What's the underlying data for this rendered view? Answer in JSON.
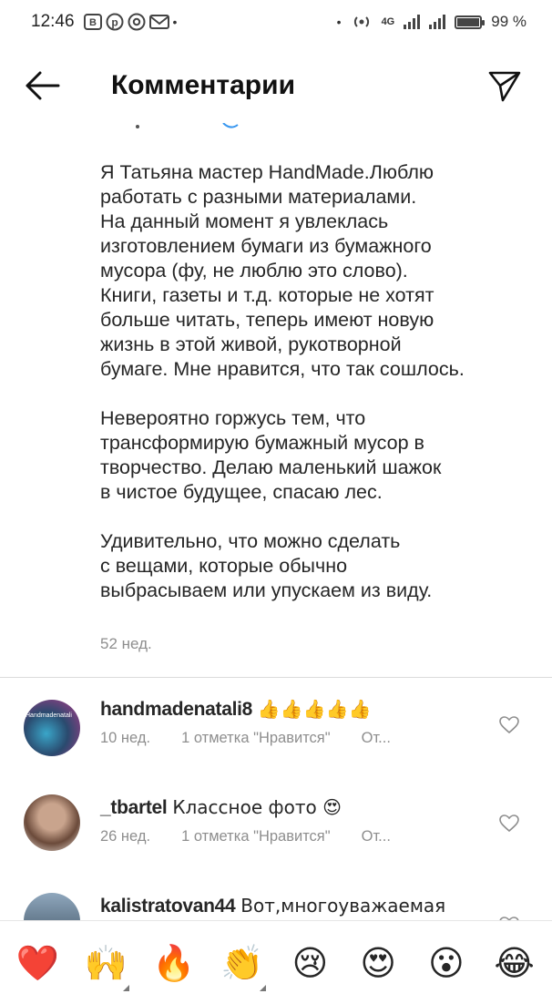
{
  "status_bar": {
    "time": "12:46",
    "left_icons": [
      "notification-b-icon",
      "pinterest-icon",
      "at-icon",
      "mail-icon"
    ],
    "network": "4G",
    "battery": "99 %",
    "battery_level": 0.99
  },
  "header": {
    "title": "Комментарии",
    "back_icon": "arrow-left-icon",
    "send_icon": "paper-plane-icon"
  },
  "caption": {
    "paragraphs": [
      [
        "Я Татьяна мастер HandMade.Люблю",
        "работать с разными материалами.",
        "На данный момент я увлеклась",
        "изготовлением бумаги из бумажного",
        "мусора (фу, не люблю это слово).",
        "Книги, газеты и т.д. которые не хотят",
        "больше читать, теперь имеют новую",
        "жизнь в этой живой, рукотворной",
        "бумаге. Мне нравится, что так сошлось."
      ],
      [
        "Невероятно горжусь тем, что",
        "трансформирую бумажный мусор в",
        "творчество. Делаю маленький шажок",
        "в чистое будущее, спасаю лес."
      ],
      [
        "Удивительно, что можно сделать",
        "с вещами, которые обычно",
        "выбрасываем или упускаем из виду."
      ]
    ],
    "time": "52 нед."
  },
  "comments": [
    {
      "username": "handmadenatali8",
      "text": "👍👍👍👍👍",
      "time": "10 нед.",
      "likes": "1 отметка \"Нравится\"",
      "reply": "От...",
      "avatar_label": "Handmadenatali",
      "avatar_colors": [
        "#2a4a6e",
        "#3aa6c9",
        "#b23a8a"
      ]
    },
    {
      "username": "_tbartel",
      "text": "Классное фото 😍",
      "time": "26 нед.",
      "likes": "1 отметка \"Нравится\"",
      "reply": "От...",
      "avatar_colors": [
        "#c9a48d",
        "#6b4a3a",
        "#efe4dc"
      ]
    },
    {
      "username": "kalistratovan44",
      "text": "Вот,многоуважаемая",
      "avatar_colors": [
        "#8fa7bd",
        "#3d5060"
      ]
    }
  ],
  "emoji_bar": [
    {
      "char": "❤️",
      "name": "heart-emoji"
    },
    {
      "char": "🙌",
      "name": "raising-hands-emoji",
      "corner": true
    },
    {
      "char": "🔥",
      "name": "fire-emoji"
    },
    {
      "char": "👏",
      "name": "clapping-hands-emoji",
      "corner": true
    },
    {
      "char": "😢",
      "name": "crying-face-emoji"
    },
    {
      "char": "😍",
      "name": "heart-eyes-emoji"
    },
    {
      "char": "😮",
      "name": "open-mouth-emoji"
    },
    {
      "char": "😂",
      "name": "tears-of-joy-emoji"
    }
  ],
  "colors": {
    "text": "#262626",
    "secondary": "#8e8e8e",
    "divider": "#dbdbdb"
  }
}
